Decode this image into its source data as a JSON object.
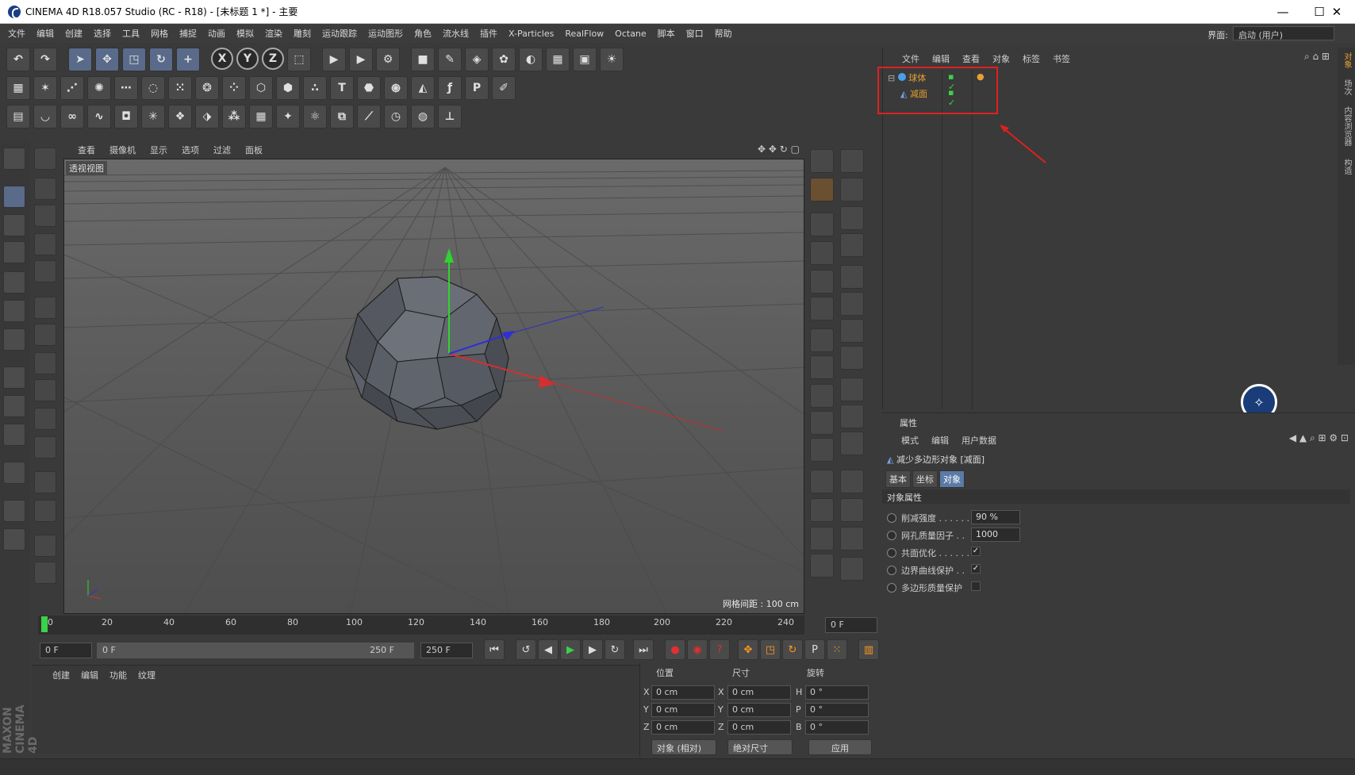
{
  "window": {
    "title": "CINEMA 4D R18.057 Studio (RC - R18) - [未标题 1 *] - 主要"
  },
  "menu": [
    "文件",
    "编辑",
    "创建",
    "选择",
    "工具",
    "网格",
    "捕捉",
    "动画",
    "模拟",
    "渲染",
    "雕刻",
    "运动跟踪",
    "运动图形",
    "角色",
    "流水线",
    "插件",
    "X-Particles",
    "RealFlow",
    "Octane",
    "脚本",
    "窗口",
    "帮助"
  ],
  "layout": {
    "label": "界面:",
    "value": "启动 (用户)"
  },
  "viewport": {
    "menu": [
      "查看",
      "摄像机",
      "显示",
      "选项",
      "过滤",
      "面板"
    ],
    "name": "透视视图",
    "grid_spacing": "网格间距 : 100 cm"
  },
  "timeline": {
    "ticks": [
      "0",
      "20",
      "40",
      "60",
      "80",
      "100",
      "120",
      "140",
      "160",
      "180",
      "200",
      "220",
      "240"
    ],
    "current_frame": "0 F",
    "start": "0 F",
    "range_start": "0 F",
    "range_end": "250 F",
    "end": "250 F"
  },
  "material": {
    "menu": [
      "创建",
      "编辑",
      "功能",
      "纹理"
    ],
    "brand": "MAXON CINEMA 4D"
  },
  "coords": {
    "headers": {
      "position": "位置",
      "size": "尺寸",
      "rotation": "旋转"
    },
    "pos": {
      "x": "0 cm",
      "y": "0 cm",
      "z": "0 cm"
    },
    "size": {
      "x": "0 cm",
      "y": "0 cm",
      "z": "0 cm"
    },
    "rot": {
      "h": "0 °",
      "p": "0 °",
      "b": "0 °"
    },
    "mode": "对象 (相对)",
    "size_mode": "绝对尺寸",
    "apply": "应用"
  },
  "object_manager": {
    "menu": [
      "文件",
      "编辑",
      "查看",
      "对象",
      "标签",
      "书签"
    ],
    "objects": [
      {
        "name": "球体",
        "icon": "sphere-icon"
      },
      {
        "name": "减面",
        "icon": "polygon-reduction-icon"
      }
    ]
  },
  "side_tabs": [
    "对象",
    "场次",
    "内容浏览器",
    "构造"
  ],
  "attributes": {
    "title": "属性",
    "menu": [
      "模式",
      "编辑",
      "用户数据"
    ],
    "object_label": "减少多边形对象 [减面]",
    "tabs": [
      "基本",
      "坐标",
      "对象"
    ],
    "section": "对象属性",
    "props": [
      {
        "label": "削减强度 . . . . . .",
        "value": "90 %"
      },
      {
        "label": "网孔质量因子 . .",
        "value": "1000"
      },
      {
        "label": "共面优化 . . . . . .",
        "checked": true
      },
      {
        "label": "边界曲线保护 . .",
        "checked": true
      },
      {
        "label": "多边形质量保护",
        "checked": false
      }
    ]
  }
}
